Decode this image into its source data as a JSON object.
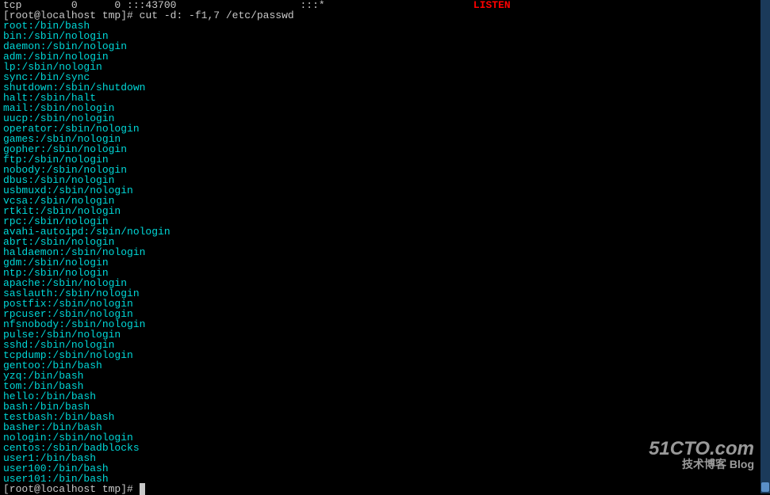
{
  "top": {
    "partial": "tcp        0      0 :::43700                    :::*",
    "spaces": "                        ",
    "listen": "LISTEN"
  },
  "prompt1": {
    "user_host": "[root@localhost tmp]#",
    "command": "cut -d: -f1,7 /etc/passwd"
  },
  "output": [
    "root:/bin/bash",
    "bin:/sbin/nologin",
    "daemon:/sbin/nologin",
    "adm:/sbin/nologin",
    "lp:/sbin/nologin",
    "sync:/bin/sync",
    "shutdown:/sbin/shutdown",
    "halt:/sbin/halt",
    "mail:/sbin/nologin",
    "uucp:/sbin/nologin",
    "operator:/sbin/nologin",
    "games:/sbin/nologin",
    "gopher:/sbin/nologin",
    "ftp:/sbin/nologin",
    "nobody:/sbin/nologin",
    "dbus:/sbin/nologin",
    "usbmuxd:/sbin/nologin",
    "vcsa:/sbin/nologin",
    "rtkit:/sbin/nologin",
    "rpc:/sbin/nologin",
    "avahi-autoipd:/sbin/nologin",
    "abrt:/sbin/nologin",
    "haldaemon:/sbin/nologin",
    "gdm:/sbin/nologin",
    "ntp:/sbin/nologin",
    "apache:/sbin/nologin",
    "saslauth:/sbin/nologin",
    "postfix:/sbin/nologin",
    "rpcuser:/sbin/nologin",
    "nfsnobody:/sbin/nologin",
    "pulse:/sbin/nologin",
    "sshd:/sbin/nologin",
    "tcpdump:/sbin/nologin",
    "gentoo:/bin/bash",
    "yzq:/bin/bash",
    "tom:/bin/bash",
    "hello:/bin/bash",
    "bash:/bin/bash",
    "testbash:/bin/bash",
    "basher:/bin/bash",
    "nologin:/sbin/nologin",
    "centos:/sbin/badblocks",
    "user1:/bin/bash",
    "user100:/bin/bash",
    "user101:/bin/bash"
  ],
  "prompt2": {
    "user_host": "[root@localhost tmp]#"
  },
  "watermark": {
    "logo": "51CTO.com",
    "sub": "技术博客 Blog"
  }
}
